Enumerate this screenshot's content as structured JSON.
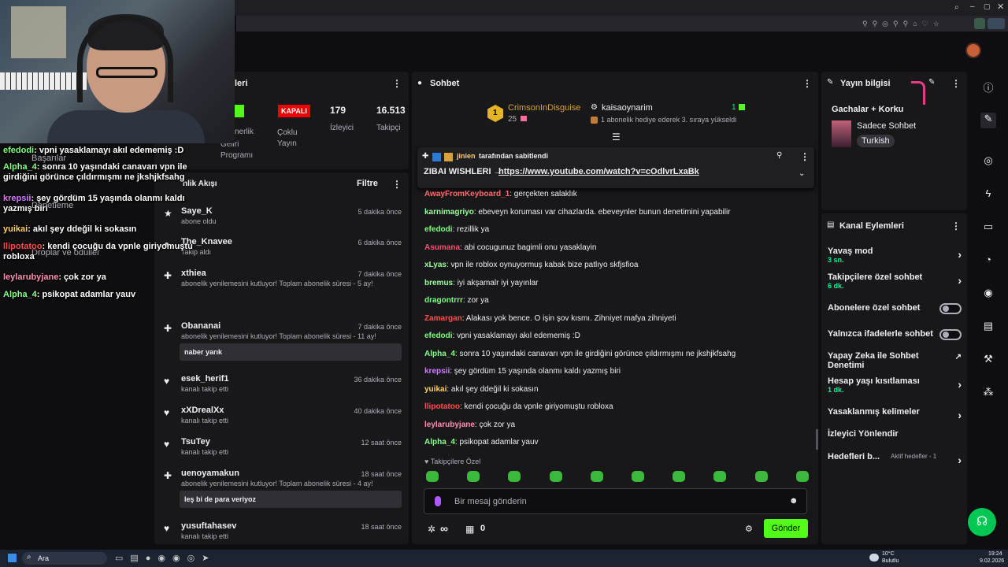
{
  "overlay_chat": [
    {
      "user": "efedodi",
      "color": "#7bff7b",
      "text": ": vpni yasaklamayı akıl edememiş :D"
    },
    {
      "user": "Alpha_4",
      "color": "#8aff8a",
      "text": ": sonra 10 yaşındaki canavarı vpn ile girdiğini görünce çıldırmışmı ne jkshjkfsahg"
    },
    {
      "user": "krepsii",
      "color": "#d27bff",
      "text": ": şey gördüm 15 yaşında olanmı kaldı yazmış biri"
    },
    {
      "user": "yuikai",
      "color": "#ffd166",
      "text": ": akıl şey ddeğil ki sokasın"
    },
    {
      "user": "llipotatoo",
      "color": "#ff4d4d",
      "text": ": kendi çocuğu da vpnle giriyomuştu robloxa"
    },
    {
      "user": "leylarubyjane",
      "color": "#ff8fb1",
      "text": ": çok zor ya"
    },
    {
      "user": "Alpha_4",
      "color": "#8aff8a",
      "text": ": psikopat adamlar yauv"
    }
  ],
  "left_panel": {
    "title_fragment": "leri",
    "stats": {
      "status": "KAPALI",
      "status_label": "Çoklu Yayın",
      "viewers": "179",
      "viewers_label": "İzleyici",
      "followers": "16.513",
      "followers_label": "Takipçi",
      "partner_fragment": "nerlik",
      "partner_sub1": "Geliri",
      "partner_sub2": "Programı"
    },
    "menu": [
      "Başarılar",
      "Denetleme",
      "Droplar ve ödüller"
    ],
    "activity_title": "nlik Akışı",
    "filter_label": "Filtre",
    "activity": [
      {
        "name": "Saye_K",
        "sub": "abone oldu",
        "time": "5 dakika önce"
      },
      {
        "name": "The_Knavee",
        "sub": "Takip aldı",
        "time": "6 dakika önce"
      },
      {
        "name": "xthiea",
        "sub": "abonelik yenilemesini kutluyor! Toplam abonelik süresi - 5 ay!",
        "time": "7 dakika önce"
      },
      {
        "name": "Obananai",
        "sub": "abonelik yenilemesini kutluyor! Toplam abonelik süresi - 11 ay!",
        "time": "7 dakika önce",
        "message": "naber yarık"
      },
      {
        "name": "esek_herif1",
        "sub": "kanalı takip etti",
        "time": "36 dakika önce"
      },
      {
        "name": "xXDrealXx",
        "sub": "kanalı takip etti",
        "time": "40 dakika önce"
      },
      {
        "name": "TsuTey",
        "sub": "kanalı takip etti",
        "time": "12 saat önce"
      },
      {
        "name": "uenoyamakun",
        "sub": "abonelik yenilemesini kutluyor! Toplam abonelik süresi - 4 ay!",
        "time": "18 saat önce",
        "message": "leş bi de para veriyoz"
      },
      {
        "name": "yusuftahasev",
        "sub": "kanalı takip etti",
        "time": "18 saat önce"
      }
    ]
  },
  "chat": {
    "title": "Sohbet",
    "hype": {
      "rank": "1",
      "user": "CrimsonInDisguise",
      "count": "25",
      "user2": "kaisaoynarim",
      "count2": "1",
      "sub_text": "1 abonelik hediye ederek 3. sıraya yükseldi"
    },
    "pinned": {
      "by": "jinien",
      "by_suffix": "tarafından sabitlendi",
      "title": "ZIBAI WISHLERI →",
      "link": "https://www.youtube.com/watch?v=cOdlvrLxaBk"
    },
    "messages": [
      {
        "user": "AwayFromKeyboard_1",
        "color": "#ff6b6b",
        "text": ": gerçekten salaklık"
      },
      {
        "user": "karnimagriyo",
        "color": "#9bff9b",
        "text": ": ebeveyn koruması var cihazlarda. ebeveynler bunun denetimini yapabilir"
      },
      {
        "user": "efedodi",
        "color": "#7bff7b",
        "text": ": rezillik ya"
      },
      {
        "user": "Asumana",
        "color": "#ff4d6d",
        "text": ": abi cocugunuz bagimli onu yasaklayin"
      },
      {
        "user": "xLyas",
        "color": "#9bff9b",
        "text": ": vpn ile roblox oynuyormuş kabak bize patlıyo skfjsfioa"
      },
      {
        "user": "bremus",
        "color": "#9bff9b",
        "text": ": iyi akşamalr iyi yayınlar"
      },
      {
        "user": "dragontrrr",
        "color": "#7bff7b",
        "text": ": zor ya"
      },
      {
        "user": "Zamargan",
        "color": "#ff4d4d",
        "text": ": Alakası yok bence. O işin şov kısmı. Zihniyet mafya zihniyeti"
      },
      {
        "user": "efedodi",
        "color": "#7bff7b",
        "text": ": vpni yasaklamayı akıl edememiş :D"
      },
      {
        "user": "Alpha_4",
        "color": "#8aff8a",
        "text": ": sonra 10 yaşındaki canavarı vpn ile girdiğini görünce çıldırmışmı ne jkshjkfsahg"
      },
      {
        "user": "krepsii",
        "color": "#d27bff",
        "text": ": şey gördüm 15 yaşında olanmı kaldı yazmış biri"
      },
      {
        "user": "yuikai",
        "color": "#ffd166",
        "text": ": akıl şey ddeğil ki sokasın"
      },
      {
        "user": "llipotatoo",
        "color": "#ff4d4d",
        "text": ": kendi çocuğu da vpnle giriyomuştu robloxa"
      },
      {
        "user": "leylarubyjane",
        "color": "#ff8fb1",
        "text": ": çok zor ya"
      },
      {
        "user": "Alpha_4",
        "color": "#8aff8a",
        "text": ": psikopat adamlar yauv"
      }
    ],
    "followers_only": "Takipçilere Özel",
    "input_placeholder": "Bir mesaj gönderin",
    "infinity": "∞",
    "points": "0",
    "send_label": "Gönder"
  },
  "stream_info": {
    "title": "Yayın bilgisi",
    "stream_title": "Gachalar + Korku",
    "category": "Sadece Sohbet",
    "tag": "Turkish"
  },
  "channel_actions": {
    "title": "Kanal Eylemleri",
    "items": [
      {
        "label": "Yavaş mod",
        "sub": "3 sn.",
        "kind": "chevron"
      },
      {
        "label": "Takipçilere özel sohbet",
        "sub": "6 dk.",
        "kind": "chevron"
      },
      {
        "label": "Abonelere özel sohbet",
        "sub": "",
        "kind": "toggle"
      },
      {
        "label": "Yalnızca ifadelerle sohbet",
        "sub": "",
        "kind": "toggle"
      },
      {
        "label": "Yapay Zeka ile Sohbet Denetimi",
        "sub": "",
        "kind": "external"
      },
      {
        "label": "Hesap yaşı kısıtlaması",
        "sub": "1 dk.",
        "kind": "chevron"
      },
      {
        "label": "Yasaklanmış kelimeler",
        "sub": "",
        "kind": "chevron"
      },
      {
        "label": "İzleyici Yönlendir",
        "sub": "",
        "kind": "none"
      },
      {
        "label": "Hedefleri b...",
        "sub": "Aktif hedefler - 1",
        "kind": "chevron"
      }
    ]
  },
  "taskbar": {
    "search": "Ara",
    "weather": "10°C",
    "weather_sub": "Bulutlu",
    "time": "19:24",
    "date": "9.02.2026"
  },
  "colors": {
    "accent": "#00f593",
    "send": "#53fc18",
    "kapali": "#eb0400"
  }
}
